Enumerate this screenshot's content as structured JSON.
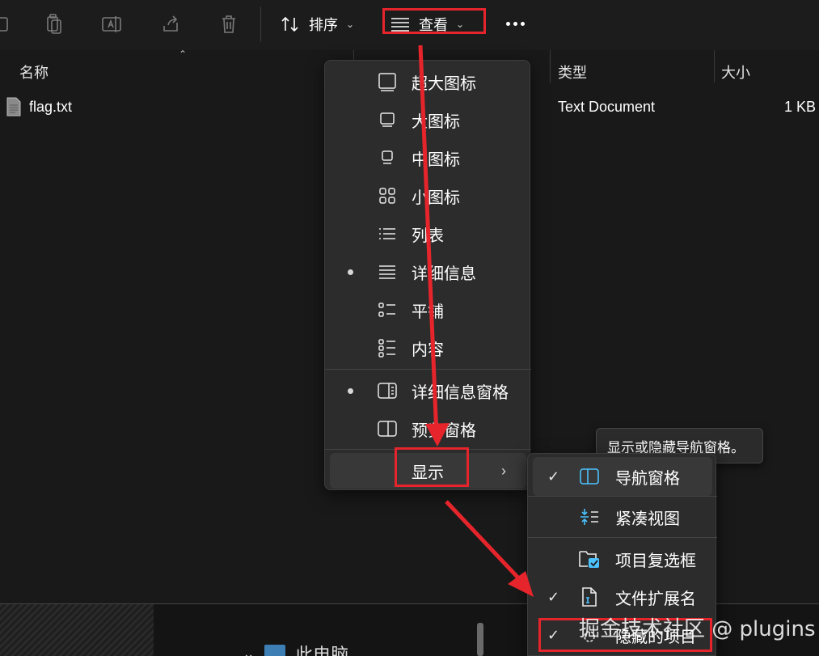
{
  "toolbar": {
    "sort_label": "排序",
    "view_label": "查看",
    "icons": [
      "copy-icon",
      "paste-icon",
      "rename-icon",
      "share-icon",
      "delete-icon"
    ]
  },
  "columns": {
    "name": "名称",
    "type": "类型",
    "size": "大小"
  },
  "files": [
    {
      "name": "flag.txt",
      "type": "Text Document",
      "size": "1 KB"
    }
  ],
  "view_menu": {
    "items": [
      {
        "label": "超大图标",
        "icon": "extra-large-icons-icon",
        "selected": false
      },
      {
        "label": "大图标",
        "icon": "large-icons-icon",
        "selected": false
      },
      {
        "label": "中图标",
        "icon": "medium-icons-icon",
        "selected": false
      },
      {
        "label": "小图标",
        "icon": "small-icons-icon",
        "selected": false
      },
      {
        "label": "列表",
        "icon": "list-icon",
        "selected": false
      },
      {
        "label": "详细信息",
        "icon": "details-icon",
        "selected": true
      },
      {
        "label": "平铺",
        "icon": "tiles-icon",
        "selected": false
      },
      {
        "label": "内容",
        "icon": "content-icon",
        "selected": false
      }
    ],
    "panes": [
      {
        "label": "详细信息窗格",
        "icon": "details-pane-icon",
        "selected": true
      },
      {
        "label": "预览窗格",
        "icon": "preview-pane-icon",
        "selected": false
      }
    ],
    "show_label": "显示"
  },
  "show_submenu": {
    "items": [
      {
        "label": "导航窗格",
        "icon": "navigation-pane-icon",
        "checked": true
      },
      {
        "label": "紧凑视图",
        "icon": "compact-view-icon",
        "checked": false
      },
      {
        "label": "项目复选框",
        "icon": "item-checkboxes-icon",
        "checked": false
      },
      {
        "label": "文件扩展名",
        "icon": "file-extensions-icon",
        "checked": true
      },
      {
        "label": "隐藏的项目",
        "icon": "hidden-items-icon",
        "checked": true
      }
    ]
  },
  "tooltip": "显示或隐藏导航窗格。",
  "bottom": {
    "label": "此电脑"
  },
  "watermark": "掘金技术社区 @ plugins",
  "colors": {
    "accent": "#4cc2ff",
    "annotation": "#e5252b",
    "background": "#191919",
    "menu": "#2c2c2c"
  }
}
